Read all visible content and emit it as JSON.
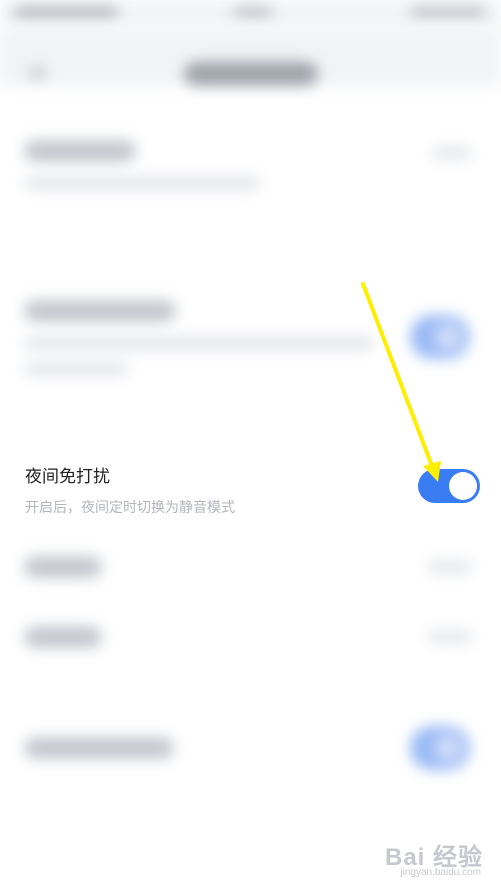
{
  "dnd_row": {
    "title": "夜间免打扰",
    "description": "开启后，夜间定时切换为静音模式",
    "toggle_on": true,
    "accent_color": "#3a7cf2"
  },
  "annotation": {
    "arrow_color": "#ffee00"
  },
  "watermark": {
    "logo_text": "Bai 经验",
    "sub_text": "jingyan.baidu.com"
  }
}
